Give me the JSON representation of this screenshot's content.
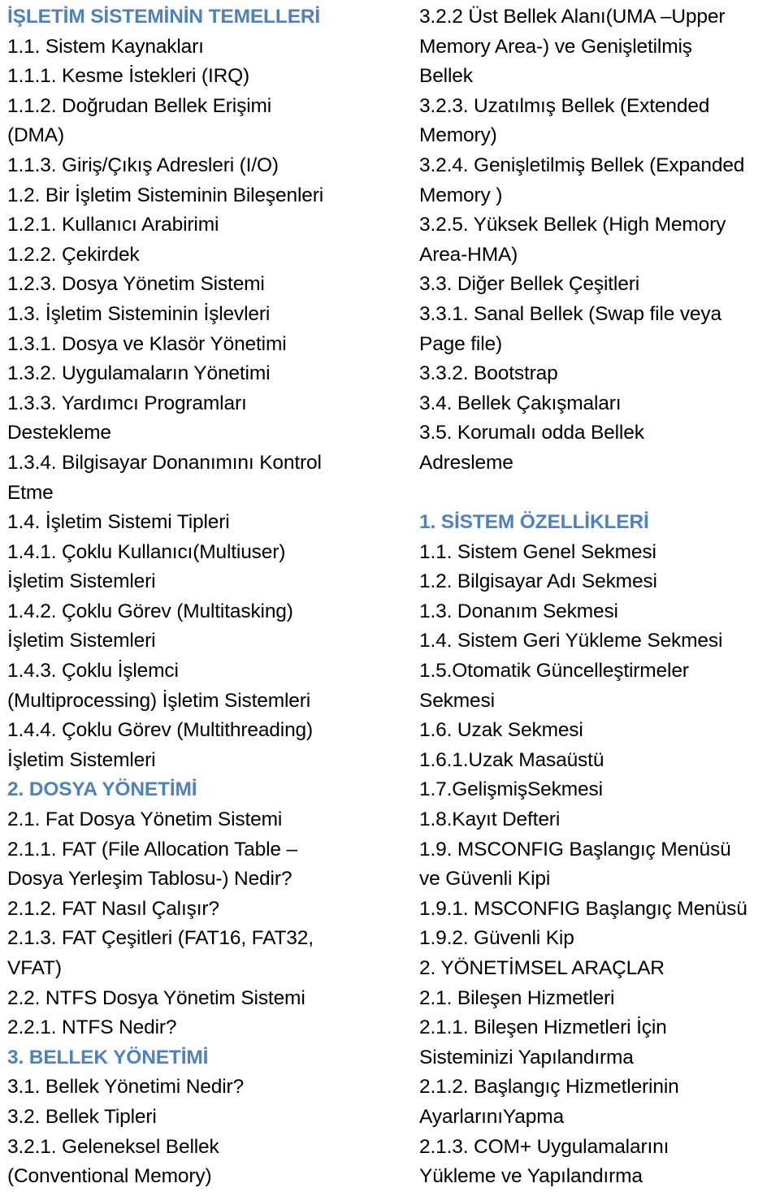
{
  "document": {
    "type": "table-of-contents",
    "language": "tr",
    "accent_color": "#4F81BD",
    "text_color": "#000000",
    "background_color": "#FFFFFF"
  },
  "left_column": {
    "lines": [
      {
        "text": "İŞLETİM SİSTEMİNİN TEMELLERİ",
        "style": "heading"
      },
      {
        "text": "1.1. Sistem Kaynakları",
        "style": "entry"
      },
      {
        "text": "1.1.1. Kesme İstekleri (IRQ)",
        "style": "entry"
      },
      {
        "text": "1.1.2. Doğrudan Bellek Erişimi",
        "style": "entry"
      },
      {
        "text": "(DMA)",
        "style": "entry"
      },
      {
        "text": "1.1.3. Giriş/Çıkış Adresleri (I/O)",
        "style": "entry"
      },
      {
        "text": "1.2. Bir İşletim Sisteminin Bileşenleri",
        "style": "entry"
      },
      {
        "text": "1.2.1. Kullanıcı Arabirimi",
        "style": "entry"
      },
      {
        "text": "1.2.2. Çekirdek",
        "style": "entry"
      },
      {
        "text": "1.2.3. Dosya Yönetim Sistemi",
        "style": "entry"
      },
      {
        "text": "1.3. İşletim Sisteminin İşlevleri",
        "style": "entry"
      },
      {
        "text": "1.3.1. Dosya ve Klasör Yönetimi",
        "style": "entry"
      },
      {
        "text": "1.3.2. Uygulamaların Yönetimi",
        "style": "entry"
      },
      {
        "text": "1.3.3. Yardımcı Programları",
        "style": "entry"
      },
      {
        "text": "Destekleme",
        "style": "entry"
      },
      {
        "text": "1.3.4. Bilgisayar Donanımını Kontrol",
        "style": "entry"
      },
      {
        "text": "Etme",
        "style": "entry"
      },
      {
        "text": "1.4. İşletim Sistemi Tipleri",
        "style": "entry"
      },
      {
        "text": "1.4.1. Çoklu Kullanıcı(Multiuser)",
        "style": "entry"
      },
      {
        "text": "İşletim Sistemleri",
        "style": "entry"
      },
      {
        "text": "1.4.2. Çoklu Görev (Multitasking)",
        "style": "entry"
      },
      {
        "text": "İşletim Sistemleri",
        "style": "entry"
      },
      {
        "text": "1.4.3. Çoklu İşlemci",
        "style": "entry"
      },
      {
        "text": "(Multiprocessing) İşletim Sistemleri",
        "style": "entry"
      },
      {
        "text": "1.4.4. Çoklu Görev (Multithreading)",
        "style": "entry"
      },
      {
        "text": "İşletim Sistemleri",
        "style": "entry"
      },
      {
        "text": "2. DOSYA YÖNETİMİ",
        "style": "heading"
      },
      {
        "text": "2.1. Fat Dosya Yönetim Sistemi",
        "style": "entry"
      },
      {
        "text": "2.1.1. FAT (File Allocation Table –",
        "style": "entry"
      },
      {
        "text": "Dosya Yerleşim Tablosu-) Nedir?",
        "style": "entry"
      },
      {
        "text": "2.1.2. FAT Nasıl Çalışır?",
        "style": "entry"
      },
      {
        "text": "2.1.3. FAT Çeşitleri (FAT16, FAT32,",
        "style": "entry"
      },
      {
        "text": "VFAT)",
        "style": "entry"
      },
      {
        "text": "2.2. NTFS Dosya Yönetim Sistemi",
        "style": "entry"
      },
      {
        "text": "2.2.1. NTFS Nedir?",
        "style": "entry"
      },
      {
        "text": "3. BELLEK YÖNETİMİ",
        "style": "heading"
      },
      {
        "text": "3.1. Bellek Yönetimi Nedir?",
        "style": "entry"
      },
      {
        "text": "3.2. Bellek Tipleri",
        "style": "entry"
      },
      {
        "text": "3.2.1. Geleneksel Bellek",
        "style": "entry"
      },
      {
        "text": "(Conventional Memory)",
        "style": "entry"
      }
    ]
  },
  "right_column": {
    "lines": [
      {
        "text": "3.2.2 Üst Bellek Alanı(UMA –Upper",
        "style": "entry"
      },
      {
        "text": "Memory Area-) ve Genişletilmiş",
        "style": "entry"
      },
      {
        "text": "Bellek",
        "style": "entry"
      },
      {
        "text": "3.2.3. Uzatılmış Bellek (Extended",
        "style": "entry"
      },
      {
        "text": "Memory)",
        "style": "entry"
      },
      {
        "text": "3.2.4. Genişletilmiş Bellek (Expanded",
        "style": "entry"
      },
      {
        "text": "Memory )",
        "style": "entry"
      },
      {
        "text": "3.2.5. Yüksek Bellek (High Memory",
        "style": "entry"
      },
      {
        "text": "Area-HMA)",
        "style": "entry"
      },
      {
        "text": "3.3. Diğer Bellek Çeşitleri",
        "style": "entry"
      },
      {
        "text": "3.3.1. Sanal Bellek (Swap file veya",
        "style": "entry"
      },
      {
        "text": "Page file)",
        "style": "entry"
      },
      {
        "text": "3.3.2. Bootstrap",
        "style": "entry"
      },
      {
        "text": "3.4. Bellek Çakışmaları",
        "style": "entry"
      },
      {
        "text": "3.5. Korumalı odda Bellek",
        "style": "entry"
      },
      {
        "text": "Adresleme",
        "style": "entry"
      },
      {
        "text": " ",
        "style": "blank"
      },
      {
        "text": "1. SİSTEM ÖZELLİKLERİ",
        "style": "heading"
      },
      {
        "text": "1.1. Sistem Genel Sekmesi",
        "style": "entry"
      },
      {
        "text": "1.2. Bilgisayar Adı Sekmesi",
        "style": "entry"
      },
      {
        "text": "1.3. Donanım Sekmesi",
        "style": "entry"
      },
      {
        "text": "1.4. Sistem Geri Yükleme Sekmesi",
        "style": "entry"
      },
      {
        "text": "1.5.Otomatik Güncelleştirmeler",
        "style": "entry"
      },
      {
        "text": "Sekmesi",
        "style": "entry"
      },
      {
        "text": "1.6. Uzak Sekmesi",
        "style": "entry"
      },
      {
        "text": "1.6.1.Uzak Masaüstü",
        "style": "entry"
      },
      {
        "text": "1.7.GelişmişSekmesi",
        "style": "entry"
      },
      {
        "text": "1.8.Kayıt Defteri",
        "style": "entry"
      },
      {
        "text": "1.9. MSCONFIG Başlangıç Menüsü",
        "style": "entry"
      },
      {
        "text": "ve Güvenli Kipi",
        "style": "entry"
      },
      {
        "text": "1.9.1. MSCONFIG Başlangıç Menüsü",
        "style": "entry"
      },
      {
        "text": "1.9.2. Güvenli Kip",
        "style": "entry"
      },
      {
        "text": "2. YÖNETİMSEL ARAÇLAR",
        "style": "entry"
      },
      {
        "text": "2.1. Bileşen Hizmetleri",
        "style": "entry"
      },
      {
        "text": "2.1.1. Bileşen Hizmetleri İçin",
        "style": "entry"
      },
      {
        "text": "Sisteminizi Yapılandırma",
        "style": "entry"
      },
      {
        "text": "2.1.2. Başlangıç Hizmetlerinin",
        "style": "entry"
      },
      {
        "text": "AyarlarınıYapma",
        "style": "entry"
      },
      {
        "text": "2.1.3. COM+ Uygulamalarını",
        "style": "entry"
      },
      {
        "text": "Yükleme ve Yapılandırma",
        "style": "entry"
      }
    ]
  }
}
